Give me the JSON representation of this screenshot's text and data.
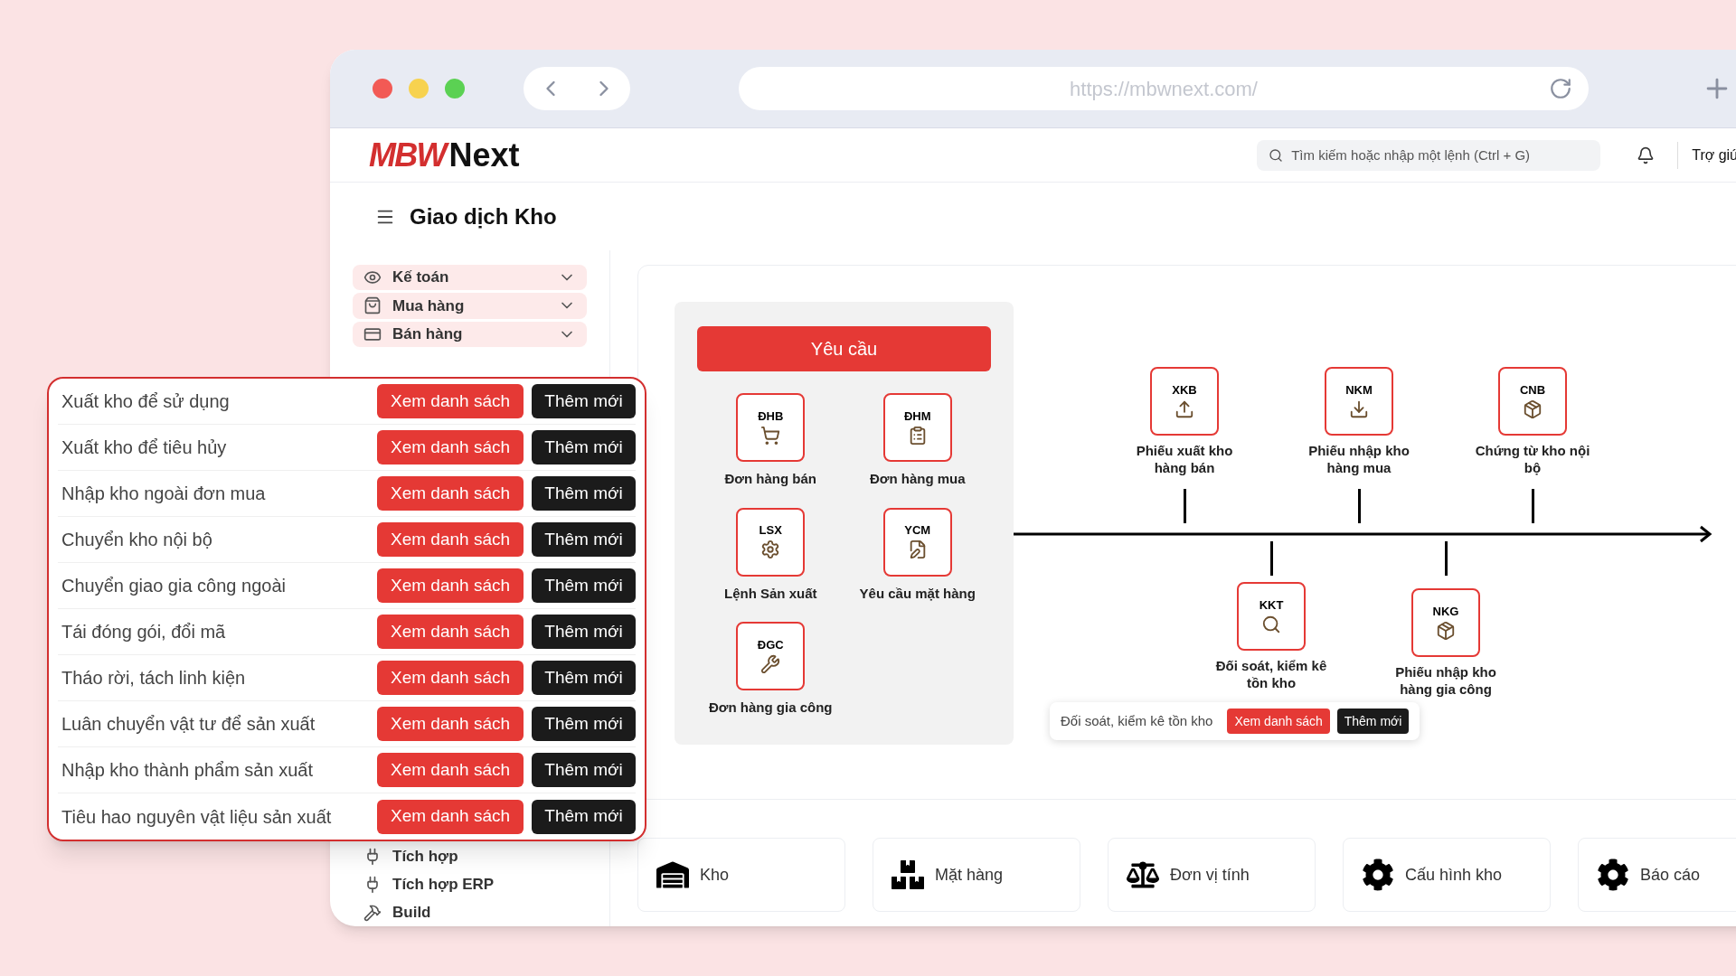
{
  "browser": {
    "url": "https://mbwnext.com/"
  },
  "app": {
    "logo": {
      "mark": "MBW",
      "name": "Next"
    },
    "search_placeholder": "Tìm kiếm hoặc nhập một lệnh (Ctrl + G)",
    "help": "Trợ giú"
  },
  "page_title": "Giao dịch Kho",
  "sidebar": [
    {
      "label": "Kế toán",
      "kind": "group"
    },
    {
      "label": "Mua hàng",
      "kind": "group"
    },
    {
      "label": "Bán hàng",
      "kind": "group"
    },
    {
      "label": "Tích hợp",
      "kind": "link"
    },
    {
      "label": "Tích hợp ERP",
      "kind": "link"
    },
    {
      "label": "Build",
      "kind": "link"
    }
  ],
  "requests": {
    "button": "Yêu cầu",
    "items": [
      {
        "code": "ĐHB",
        "label": "Đơn hàng bán"
      },
      {
        "code": "ĐHM",
        "label": "Đơn hàng mua"
      },
      {
        "code": "LSX",
        "label": "Lệnh Sản xuất"
      },
      {
        "code": "YCM",
        "label": "Yêu cầu mặt hàng"
      },
      {
        "code": "ĐGC",
        "label": "Đơn hàng gia công"
      }
    ]
  },
  "timeline": {
    "above": [
      {
        "code": "XKB",
        "label": "Phiếu xuất kho hàng bán"
      },
      {
        "code": "NKM",
        "label": "Phiếu nhập kho hàng mua"
      },
      {
        "code": "CNB",
        "label": "Chứng từ kho nội bộ"
      }
    ],
    "below": [
      {
        "code": "KKT",
        "label": "Đối soát, kiểm kê tồn kho"
      },
      {
        "code": "NKG",
        "label": "Phiếu nhập kho hàng gia công"
      }
    ]
  },
  "tooltip": {
    "label": "Đối soát, kiểm kê tồn kho",
    "view": "Xem danh sách",
    "add": "Thêm mới"
  },
  "shortcuts": [
    {
      "label": "Kho"
    },
    {
      "label": "Mặt hàng"
    },
    {
      "label": "Đơn vị tính"
    },
    {
      "label": "Cấu hình kho"
    },
    {
      "label": "Báo cáo"
    }
  ],
  "popup": {
    "rows": [
      {
        "label": "Xuất kho để sử dụng",
        "view": "Xem danh sách",
        "add": "Thêm mới"
      },
      {
        "label": "Xuất kho để tiêu hủy",
        "view": "Xem danh sách",
        "add": "Thêm mới"
      },
      {
        "label": "Nhập kho ngoài đơn mua",
        "view": "Xem danh sách",
        "add": "Thêm mới"
      },
      {
        "label": "Chuyển kho nội bộ",
        "view": "Xem danh sách",
        "add": "Thêm mới"
      },
      {
        "label": "Chuyển giao gia công ngoài",
        "view": "Xem danh sách",
        "add": "Thêm mới"
      },
      {
        "label": "Tái đóng gói, đổi mã",
        "view": "Xem danh sách",
        "add": "Thêm mới"
      },
      {
        "label": "Tháo rời, tách linh kiện",
        "view": "Xem danh sách",
        "add": "Thêm mới"
      },
      {
        "label": "Luân chuyển vật tư để sản xuất",
        "view": "Xem danh sách",
        "add": "Thêm mới"
      },
      {
        "label": "Nhập kho thành phẩm sản xuất",
        "view": "Xem danh sách",
        "add": "Thêm mới"
      },
      {
        "label": "Tiêu hao nguyên vật liệu sản xuất",
        "view": "Xem danh sách",
        "add": "Thêm mới"
      }
    ]
  }
}
